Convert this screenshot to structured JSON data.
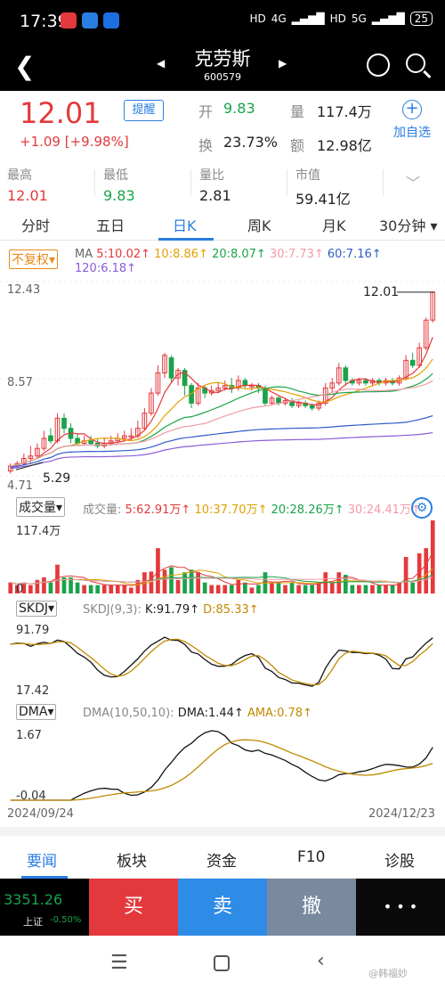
{
  "status": {
    "time": "17:39",
    "battery": "25",
    "net1": "4G",
    "net2": "5G",
    "hd": "HD"
  },
  "header": {
    "title": "克劳斯",
    "code": "600579"
  },
  "quote": {
    "price": "12.01",
    "change": "+1.09",
    "change_pct": "[+9.98%]",
    "alert": "提醒",
    "open_label": "开",
    "open": "9.83",
    "vol_label": "量",
    "vol": "117.4万",
    "turnover_label": "换",
    "turnover": "23.73%",
    "amount_label": "额",
    "amount": "12.98亿",
    "add_watch": "加自选"
  },
  "stats": [
    {
      "label": "最高",
      "value": "12.01"
    },
    {
      "label": "最低",
      "value": "9.83"
    },
    {
      "label": "量比",
      "value": "2.81"
    },
    {
      "label": "市值",
      "value": "59.41亿"
    }
  ],
  "tabs": [
    "分时",
    "五日",
    "日K",
    "周K",
    "月K",
    "30分钟"
  ],
  "active_tab": "日K",
  "ma_legend": {
    "fq": "不复权",
    "ma": "MA",
    "ma5": "5:10.02↑",
    "ma10": "10:8.86↑",
    "ma20": "20:8.07↑",
    "ma30": "30:7.73↑",
    "ma60": "60:7.16↑",
    "ma120": "120:6.18↑"
  },
  "price_axis": {
    "top": "12.43",
    "mid": "8.57",
    "bottom": "4.71",
    "high_mark": "12.01",
    "low_mark": "5.29"
  },
  "vol_legend": {
    "sel": "成交量",
    "name": "成交量:",
    "v5": "5:62.91万↑",
    "v10": "10:37.70万↑",
    "v20": "20:28.26万↑",
    "v30": "30:24.41万↑",
    "top": "117.4万",
    "zero": "0"
  },
  "skdj_legend": {
    "sel": "SKDJ",
    "params": "SKDJ(9,3):",
    "k": "K:91.79↑",
    "d": "D:85.33↑",
    "top": "91.79",
    "bottom": "17.42"
  },
  "dma_legend": {
    "sel": "DMA",
    "params": "DMA(10,50,10):",
    "dma": "DMA:1.44↑",
    "ama": "AMA:0.78↑",
    "top": "1.67",
    "bottom": "-0.04"
  },
  "dates": {
    "start": "2024/09/24",
    "end": "2024/12/23"
  },
  "news_tabs": [
    "要闻",
    "板块",
    "资金",
    "F10",
    "诊股"
  ],
  "trade": {
    "index_value": "3351.26",
    "index_name": "上证",
    "index_change": "-0.50%",
    "buy": "买",
    "sell": "卖",
    "cancel": "撤",
    "more": "• • •"
  },
  "watermark": "@韩福妙",
  "colors": {
    "up": "#e4393c",
    "down": "#1aa34a",
    "accent": "#2a7de1",
    "buy": "#e4393c",
    "sell": "#2e8be6",
    "cancel": "#7a8a9e"
  },
  "chart_data": {
    "type": "candlestick",
    "x_start": "2024/09/24",
    "x_end": "2024/12/23",
    "ylim": [
      4.71,
      12.43
    ],
    "candles": [
      [
        4.9,
        5.1,
        4.8,
        5.2
      ],
      [
        5.1,
        5.2,
        5.0,
        5.3
      ],
      [
        5.2,
        5.4,
        5.1,
        5.6
      ],
      [
        5.4,
        5.5,
        5.2,
        5.9
      ],
      [
        5.5,
        5.8,
        5.4,
        6.0
      ],
      [
        5.8,
        6.2,
        5.7,
        6.5
      ],
      [
        6.3,
        6.1,
        6.0,
        6.6
      ],
      [
        6.1,
        7.0,
        6.0,
        7.2
      ],
      [
        7.0,
        6.6,
        6.4,
        7.2
      ],
      [
        6.6,
        6.2,
        6.0,
        6.8
      ],
      [
        6.2,
        6.0,
        5.9,
        6.4
      ],
      [
        6.0,
        6.1,
        5.9,
        6.3
      ],
      [
        6.1,
        6.0,
        5.9,
        6.3
      ],
      [
        6.0,
        5.9,
        5.8,
        6.2
      ],
      [
        5.9,
        6.0,
        5.8,
        6.2
      ],
      [
        6.0,
        6.1,
        5.9,
        6.3
      ],
      [
        6.1,
        6.2,
        6.0,
        6.4
      ],
      [
        6.2,
        6.3,
        6.1,
        6.5
      ],
      [
        6.3,
        6.3,
        6.1,
        6.6
      ],
      [
        6.3,
        6.6,
        6.2,
        6.9
      ],
      [
        6.6,
        7.2,
        6.5,
        7.4
      ],
      [
        7.2,
        8.0,
        7.1,
        8.2
      ],
      [
        8.0,
        8.8,
        7.9,
        9.1
      ],
      [
        8.8,
        9.5,
        8.6,
        9.6
      ],
      [
        9.4,
        8.6,
        8.4,
        9.5
      ],
      [
        8.6,
        8.9,
        8.3,
        9.0
      ],
      [
        8.9,
        8.3,
        7.9,
        9.0
      ],
      [
        8.3,
        7.6,
        7.4,
        8.4
      ],
      [
        7.6,
        8.2,
        7.5,
        8.4
      ],
      [
        8.2,
        8.0,
        7.8,
        8.3
      ],
      [
        8.0,
        8.1,
        7.9,
        8.3
      ],
      [
        8.1,
        8.2,
        8.0,
        8.4
      ],
      [
        8.2,
        8.3,
        8.1,
        8.5
      ],
      [
        8.3,
        8.2,
        8.0,
        8.6
      ],
      [
        8.2,
        8.5,
        8.1,
        8.7
      ],
      [
        8.5,
        8.3,
        8.2,
        8.6
      ],
      [
        8.3,
        8.3,
        8.1,
        8.4
      ],
      [
        8.3,
        8.2,
        8.0,
        8.4
      ],
      [
        8.2,
        7.6,
        7.5,
        8.3
      ],
      [
        7.6,
        7.8,
        7.5,
        7.9
      ],
      [
        7.8,
        7.6,
        7.5,
        7.9
      ],
      [
        7.6,
        7.7,
        7.5,
        7.8
      ],
      [
        7.7,
        7.5,
        7.4,
        7.8
      ],
      [
        7.5,
        7.6,
        7.4,
        7.7
      ],
      [
        7.6,
        7.5,
        7.4,
        7.7
      ],
      [
        7.5,
        7.4,
        7.3,
        7.6
      ],
      [
        7.4,
        7.6,
        7.3,
        7.7
      ],
      [
        7.6,
        8.2,
        7.5,
        8.4
      ],
      [
        8.2,
        8.4,
        8.0,
        8.6
      ],
      [
        8.4,
        9.0,
        8.3,
        9.2
      ],
      [
        9.0,
        8.5,
        8.3,
        9.1
      ],
      [
        8.5,
        8.4,
        8.3,
        8.6
      ],
      [
        8.4,
        8.5,
        8.3,
        8.6
      ],
      [
        8.5,
        8.4,
        8.3,
        8.6
      ],
      [
        8.4,
        8.5,
        8.3,
        8.6
      ],
      [
        8.5,
        8.4,
        8.3,
        8.6
      ],
      [
        8.4,
        8.5,
        8.3,
        8.6
      ],
      [
        8.5,
        8.4,
        8.3,
        8.6
      ],
      [
        8.4,
        8.6,
        8.3,
        8.7
      ],
      [
        8.6,
        9.3,
        8.5,
        9.5
      ],
      [
        9.3,
        9.1,
        9.0,
        9.6
      ],
      [
        9.1,
        9.8,
        9.0,
        10.0
      ],
      [
        9.8,
        10.9,
        9.7,
        11.0
      ],
      [
        10.9,
        12.01,
        10.8,
        12.01
      ]
    ],
    "volume_max": "117.4万"
  }
}
